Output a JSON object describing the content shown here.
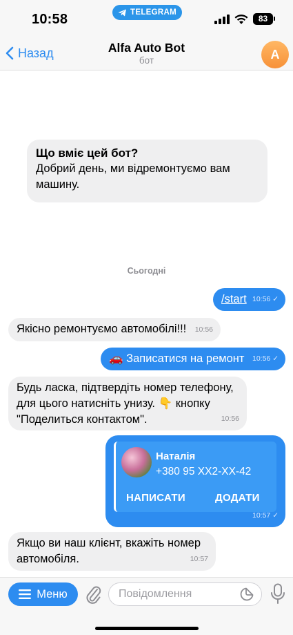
{
  "status_bar": {
    "time": "10:58",
    "app_pill": "TELEGRAM",
    "battery": "83"
  },
  "header": {
    "back_label": "Назад",
    "title": "Alfa Auto Bot",
    "subtitle": "бот",
    "avatar_letter": "A"
  },
  "intro": {
    "title": "Що вміє цей бот?",
    "text": "Добрий день, ми відремонтуємо вам машину."
  },
  "date_separator": "Сьогодні",
  "messages": [
    {
      "dir": "out",
      "text": "/start",
      "time": "10:56",
      "link": true
    },
    {
      "dir": "in",
      "text": "Якісно ремонтуємо автомобілі!!!",
      "time": "10:56"
    },
    {
      "dir": "out",
      "text": "🚗 Записатися на ремонт",
      "time": "10:56"
    },
    {
      "dir": "in",
      "text": "Будь ласка, підтвердіть номер телефону, для цього натисніть унизу. 👇 кнопку \"Поделиться контактом\".",
      "time": "10:56"
    },
    {
      "dir": "out",
      "type": "contact",
      "time": "10:57"
    },
    {
      "dir": "in",
      "text": "Якщо ви наш клієнт, вкажіть номер автомобіля.",
      "time": "10:57"
    }
  ],
  "contact": {
    "name": "Наталія",
    "phone": "+380 95 XX2-XX-42",
    "write_label": "НАПИСАТИ",
    "add_label": "ДОДАТИ"
  },
  "input_bar": {
    "menu_label": "Меню",
    "placeholder": "Повідомлення"
  },
  "colors": {
    "accent": "#2d8cf0",
    "incoming_bubble": "#efeff0",
    "avatar": "#f79138"
  }
}
